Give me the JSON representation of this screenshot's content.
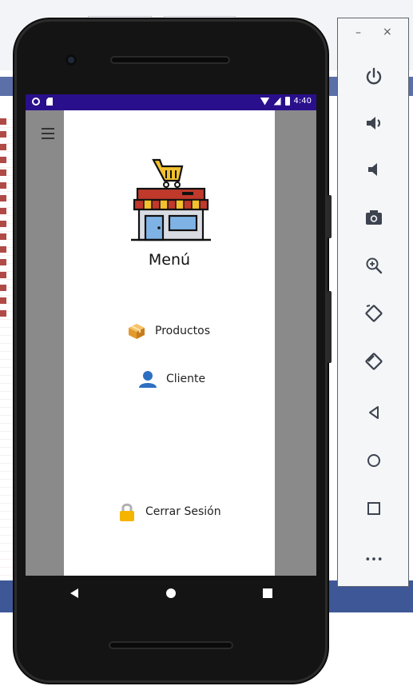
{
  "app": {
    "menu_title": "Menú",
    "items": [
      {
        "label": "Productos",
        "icon": "package-icon"
      },
      {
        "label": "Cliente",
        "icon": "user-icon"
      }
    ],
    "logout_label": "Cerrar Sesión",
    "logo_icon": "store-cart-icon"
  },
  "status_bar": {
    "time": "4:40"
  },
  "emulator": {
    "minimize": "–",
    "close": "×",
    "more": "•••",
    "buttons": [
      "power-icon",
      "volume-up-icon",
      "volume-down-icon",
      "camera-icon",
      "zoom-icon",
      "rotate-left-icon",
      "rotate-right-icon",
      "back-icon",
      "home-icon",
      "overview-icon",
      "more-icon"
    ]
  },
  "colors": {
    "status_bar": "#2a0f8c",
    "scrim": "#8a8a8a",
    "awning_red": "#c0392b",
    "awning_yellow": "#f2c12e",
    "store_blue": "#7fb3e6"
  }
}
